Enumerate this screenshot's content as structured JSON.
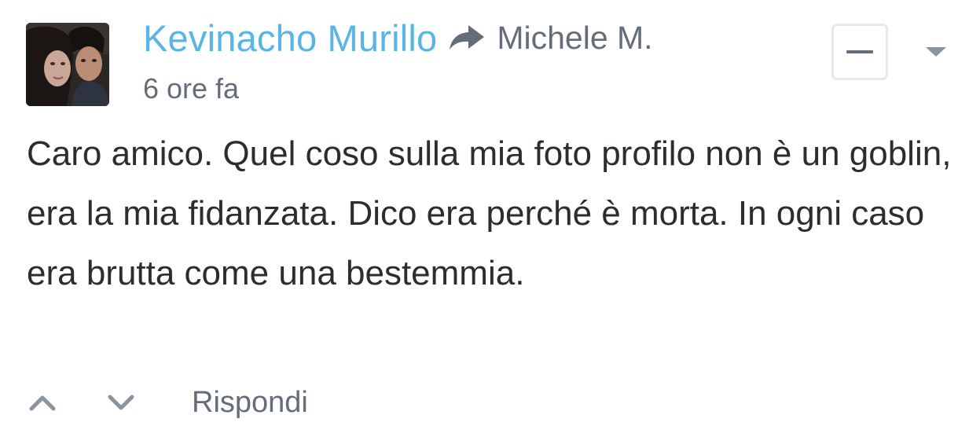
{
  "comment": {
    "author": "Kevinacho Murillo",
    "reply_to": "Michele M.",
    "timestamp": "6 ore fa",
    "message": "Caro amico. Quel coso sulla mia foto profilo non è un goblin, era la mia fidanzata. Dico era perché è morta. In ogni caso era brutta come una bestemmia.",
    "actions": {
      "reply_label": "Rispondi"
    },
    "icons": {
      "reply_arrow": "share-arrow-icon",
      "collapse": "minus-icon",
      "menu": "caret-down-icon",
      "upvote": "chevron-up-icon",
      "downvote": "chevron-down-icon"
    }
  },
  "colors": {
    "author": "#5ab4e5",
    "meta": "#656c7a",
    "body_text": "#2a2e2e",
    "icon_light": "#8a939e",
    "border": "#e6e8eb"
  }
}
